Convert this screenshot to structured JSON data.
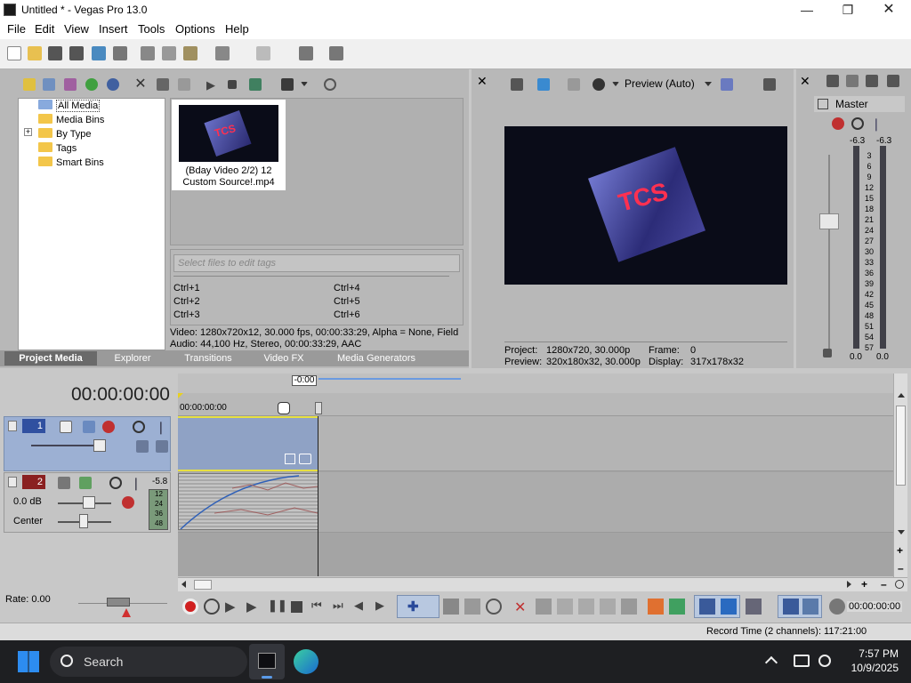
{
  "window": {
    "title": "Untitled * - Vegas Pro 13.0"
  },
  "menu": [
    "File",
    "Edit",
    "View",
    "Insert",
    "Tools",
    "Options",
    "Help"
  ],
  "media": {
    "tree": [
      "All Media",
      "Media Bins",
      "By Type",
      "Tags",
      "Smart Bins"
    ],
    "tree_expander": "+",
    "thumbnail_label": "(Bday Video 2/2) 12 Custom Source!.mp4",
    "thumb_text": "TCS",
    "tags_placeholder": "Select files to edit tags",
    "shortcuts": [
      "Ctrl+1",
      "Ctrl+4",
      "Ctrl+2",
      "Ctrl+5",
      "Ctrl+3",
      "Ctrl+6"
    ],
    "info_video": "Video: 1280x720x12, 30.000 fps, 00:00:33:29, Alpha = None, Field",
    "info_audio": "Audio: 44,100 Hz, Stereo, 00:00:33:29, AAC"
  },
  "tabs": [
    "Project Media",
    "Explorer",
    "Transitions",
    "Video FX",
    "Media Generators"
  ],
  "preview": {
    "mode": "Preview (Auto)",
    "project_label": "Project:",
    "project_value": "1280x720, 30.000p",
    "preview_label": "Preview:",
    "preview_value": "320x180x32, 30.000p",
    "frame_label": "Frame:",
    "frame_value": "0",
    "display_label": "Display:",
    "display_value": "317x178x32"
  },
  "master": {
    "label": "Master",
    "left_peak": "-6.3",
    "right_peak": "-6.3",
    "scale": [
      "3",
      "6",
      "9",
      "12",
      "15",
      "18",
      "21",
      "24",
      "27",
      "30",
      "33",
      "36",
      "39",
      "42",
      "45",
      "48",
      "51",
      "54",
      "57"
    ],
    "left_val": "0.0",
    "right_val": "0.0"
  },
  "timeline": {
    "timecode": "00:00:00:00",
    "marker": "-0:00",
    "ruler_start": "00:00:00:00",
    "track1_num": "1",
    "track2_num": "2",
    "track2_peak": "-5.8",
    "track2_vol": "0.0 dB",
    "track2_pan": "Center",
    "track2_meter": [
      "12",
      "24",
      "36",
      "48"
    ],
    "rate": "Rate: 0.00",
    "cursor_time": "00:00:00:00",
    "record_time": "Record Time (2 channels): 117:21:00"
  },
  "taskbar": {
    "search": "Search",
    "time": "7:57 PM",
    "date": "10/9/2025"
  },
  "colors": {
    "selected_track": "#9cb0d3",
    "video_event": "#8fa2c5",
    "audio_track": "#2f60b8",
    "timeline_bg": "#a4a4a4",
    "record_red": "#d02020"
  }
}
